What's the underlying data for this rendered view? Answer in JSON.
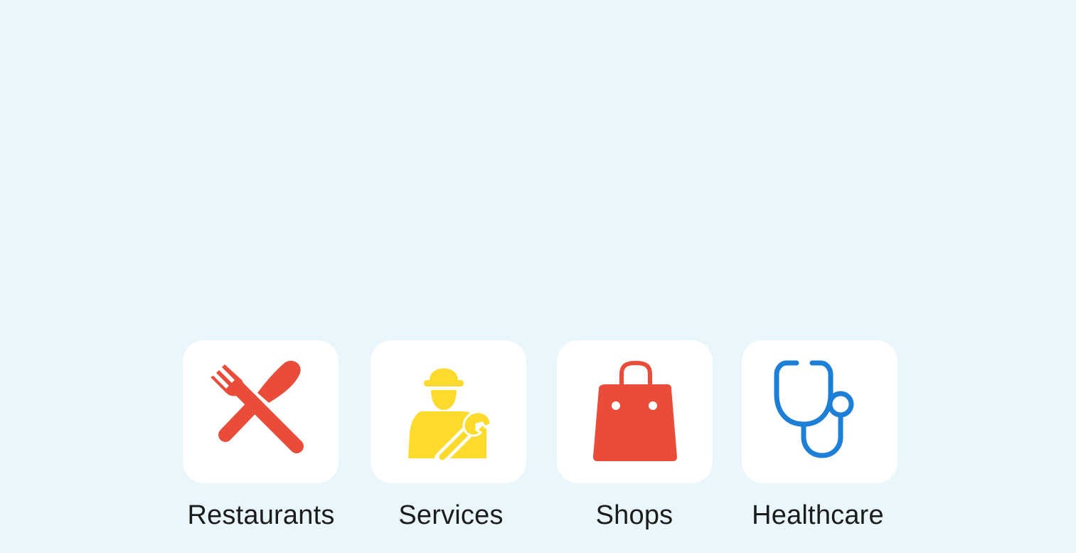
{
  "categories": [
    {
      "label": "Restaurants",
      "icon": "fork-knife-icon",
      "color": "#ea4c3a"
    },
    {
      "label": "Services",
      "icon": "worker-wrench-icon",
      "color": "#fddb2c"
    },
    {
      "label": "Shops",
      "icon": "shopping-bag-icon",
      "color": "#ea4c3a"
    },
    {
      "label": "Healthcare",
      "icon": "stethoscope-icon",
      "color": "#1e7fd6"
    }
  ]
}
